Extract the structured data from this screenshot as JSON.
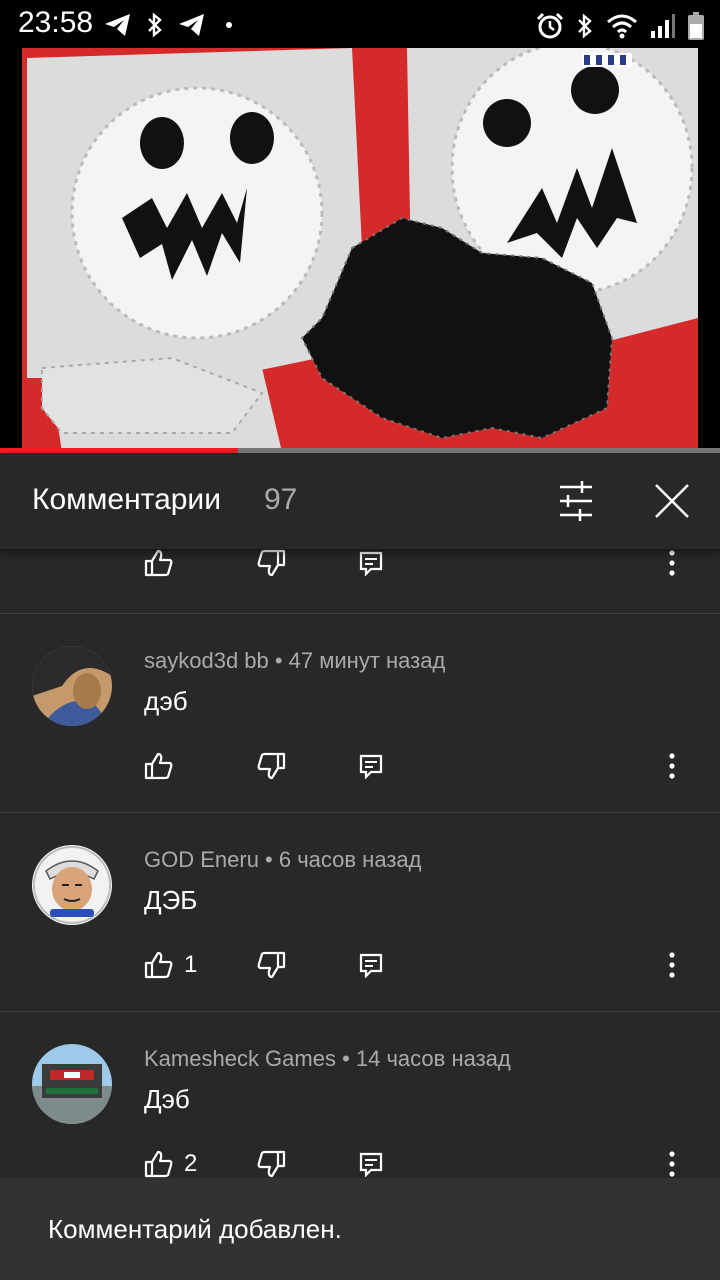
{
  "status_bar": {
    "time": "23:58",
    "left_icons": [
      "telegram-icon",
      "bluetooth-icon",
      "telegram-icon"
    ],
    "right_icons": [
      "alarm-icon",
      "bluetooth-icon",
      "wifi-icon",
      "signal-icon",
      "battery-icon"
    ]
  },
  "video": {
    "progress": 0.33,
    "colors": {
      "progress": "#e52222",
      "track": "#777777"
    }
  },
  "panel": {
    "title": "Комментарии",
    "count": "97",
    "filter_icon": "sliders-icon",
    "close_icon": "close-icon"
  },
  "comments": [
    {
      "author": "saykod3d bb",
      "time": "47 минут назад",
      "meta": "saykod3d bb • 47 минут назад",
      "text": "дэб",
      "likes": ""
    },
    {
      "author": "GOD Eneru",
      "time": "6 часов назад",
      "meta": "GOD Eneru • 6 часов назад",
      "text": "ДЭБ",
      "likes": "1"
    },
    {
      "author": "Kamesheck Games",
      "time": "14 часов назад",
      "meta": "Kamesheck Games • 14 часов назад",
      "text": "Дэб",
      "likes": "2"
    }
  ],
  "snackbar": {
    "text": "Комментарий добавлен."
  },
  "colors": {
    "panel_bg": "#282828",
    "snackbar_bg": "#323232",
    "secondary_text": "#aaaaaa"
  }
}
